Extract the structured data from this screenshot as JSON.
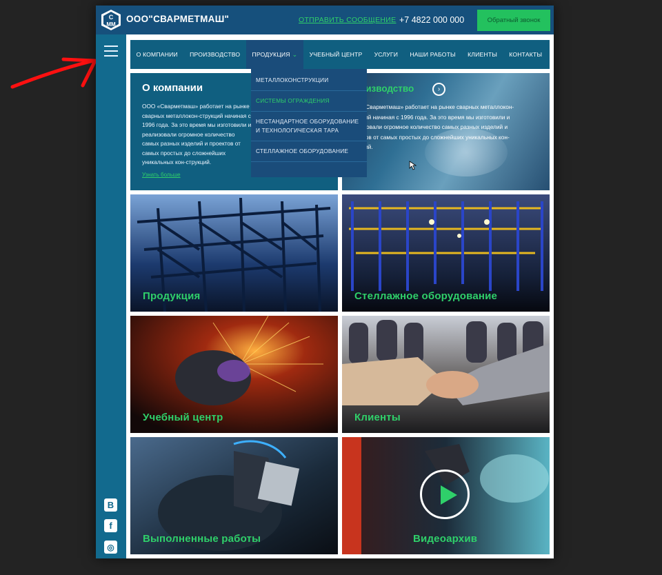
{
  "header": {
    "logo_letters": "СММ",
    "brand": "ООО\"СВАРМЕТМАШ\"",
    "send_message": "ОТПРАВИТЬ СООБЩЕНИЕ",
    "phone": "+7 4822 000 000",
    "callback_label": "Обратный звонок"
  },
  "nav": {
    "items": [
      {
        "label": "О КОМПАНИИ"
      },
      {
        "label": "ПРОИЗВОДСТВО"
      },
      {
        "label": "ПРОДУКЦИЯ",
        "active": true
      },
      {
        "label": "УЧЕБНЫЙ ЦЕНТР"
      },
      {
        "label": "УСЛУГИ"
      },
      {
        "label": "НАШИ РАБОТЫ"
      },
      {
        "label": "КЛИЕНТЫ"
      },
      {
        "label": "КОНТАКТЫ"
      }
    ]
  },
  "dropdown": {
    "items": [
      {
        "label": "МЕТАЛЛОКОНСТРУКЦИИ"
      },
      {
        "label": "СИСТЕМЫ ОГРАЖДЕНИЯ",
        "hover": true
      },
      {
        "label": "НЕСТАНДАРТНОЕ ОБОРУДОВАНИЕ И ТЕХНОЛОГИЧЕСКАЯ ТАРА"
      },
      {
        "label": "СТЕЛЛАЖНОЕ ОБОРУДОВАНИЕ"
      }
    ]
  },
  "about": {
    "title": "О компании",
    "text": "ООО «Сварметмаш» работает на рынке сварных металлокон-струкций начиная с 1996 года. За это время мы изготовили и реализовали огромное количество самых разных изделий и проектов от самых простых до сложнейших уникальных кон-струкций.",
    "more_link": "Узнать больше"
  },
  "production": {
    "title": "Производство",
    "text": "ООО «Сварметмаш» работает на рынке сварных металлокон-струкций начиная с 1996 года. За это время мы изготовили и реализовали огромное количество самых разных изделий и проектов от самых простых до сложнейших уникальных кон-струкций."
  },
  "tiles": {
    "products": "Продукция",
    "racks": "Стеллажное оборудование",
    "training": "Учебный центр",
    "clients": "Клиенты",
    "works": "Выполненные работы",
    "video": "Видеоархив"
  },
  "social": {
    "vk": "B",
    "fb": "f",
    "ig": "◎"
  },
  "colors": {
    "header": "#16507c",
    "rail": "#126a8e",
    "accent_green": "#2fd06a",
    "dropdown": "#1a4c7a"
  },
  "icons": [
    "hamburger-icon",
    "vk-icon",
    "facebook-icon",
    "instagram-icon",
    "arrow-right-icon",
    "play-icon"
  ]
}
